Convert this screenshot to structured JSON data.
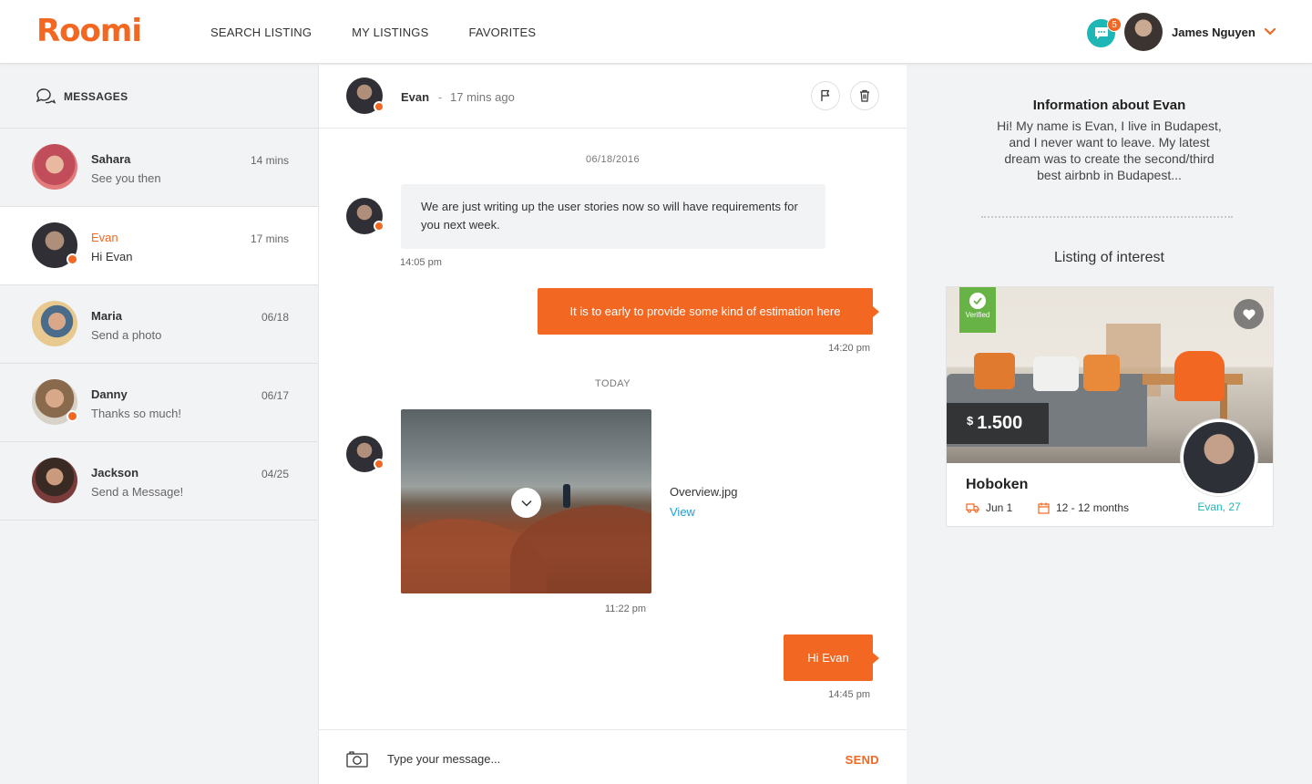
{
  "header": {
    "logo": "Roomi",
    "nav": [
      "SEARCH LISTING",
      "MY LISTINGS",
      "FAVORITES"
    ],
    "notification_count": "5",
    "user_name": "James Nguyen"
  },
  "sidebar": {
    "title": "MESSAGES",
    "conversations": [
      {
        "name": "Sahara",
        "preview": "See you then",
        "time": "14 mins",
        "online": false,
        "active": false
      },
      {
        "name": "Evan",
        "preview": "Hi Evan",
        "time": "17 mins",
        "online": true,
        "active": true
      },
      {
        "name": "Maria",
        "preview": "Send a photo",
        "time": "06/18",
        "online": false,
        "active": false
      },
      {
        "name": "Danny",
        "preview": "Thanks so much!",
        "time": "06/17",
        "online": true,
        "active": false
      },
      {
        "name": "Jackson",
        "preview": "Send a Message!",
        "time": "04/25",
        "online": false,
        "active": false
      }
    ]
  },
  "chat": {
    "contact_name": "Evan",
    "separator": "-",
    "contact_time": "17 mins ago",
    "date_1": "06/18/2016",
    "msg_1": "We are just writing up the user stories now so will have requirements for you next week.",
    "msg_1_time": "14:05 pm",
    "msg_2": "It is to early to provide some kind of estimation here",
    "msg_2_time": "14:20 pm",
    "date_2": "TODAY",
    "file_name": "Overview.jpg",
    "file_view": "View",
    "file_time": "11:22 pm",
    "msg_3": "Hi Evan",
    "msg_3_time": "14:45 pm",
    "composer_placeholder": "Type your message...",
    "send_label": "SEND"
  },
  "info": {
    "title": "Information about Evan",
    "bio": "Hi! My name is Evan, I live in Budapest, and I never want to leave. My latest dream was to create the second/third best airbnb in Budapest...",
    "listing_heading": "Listing of interest",
    "listing": {
      "verified": "Verified",
      "currency": "$",
      "price": "1.500",
      "title": "Hoboken",
      "move_in": "Jun 1",
      "duration": "12 - 12 months",
      "host": "Evan, 27"
    }
  },
  "colors": {
    "accent": "#f26722",
    "teal": "#1fb6b6",
    "link": "#1a9fd9",
    "verified": "#67b346"
  }
}
